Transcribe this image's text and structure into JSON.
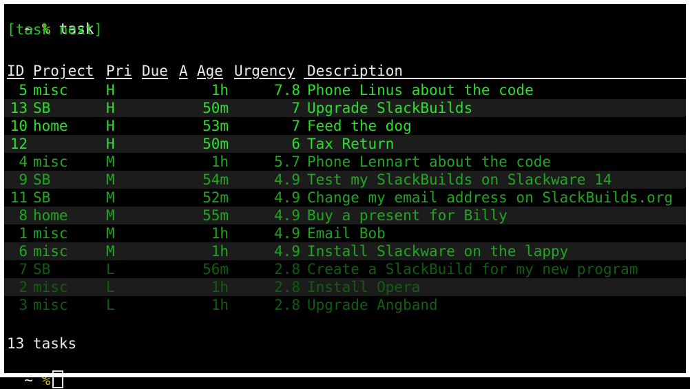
{
  "prompt": {
    "tilde": "~",
    "pct": "%",
    "command": "task"
  },
  "report_label": "[task next]",
  "columns": {
    "id": "ID",
    "project": "Project",
    "pri": "Pri",
    "due": "Due",
    "a": "A",
    "age": "Age",
    "urgency": "Urgency",
    "description": "Description"
  },
  "rows": [
    {
      "id": "5",
      "project": "misc",
      "pri": "H",
      "age": "1h",
      "urgency": "7.8",
      "description": "Phone Linus about the code",
      "color": "#2be02b"
    },
    {
      "id": "13",
      "project": "SB",
      "pri": "H",
      "age": "50m",
      "urgency": "7",
      "description": "Upgrade SlackBuilds",
      "color": "#2be02b"
    },
    {
      "id": "10",
      "project": "home",
      "pri": "H",
      "age": "53m",
      "urgency": "7",
      "description": "Feed the dog",
      "color": "#2be02b"
    },
    {
      "id": "12",
      "project": "",
      "pri": "H",
      "age": "50m",
      "urgency": "6",
      "description": "Tax Return",
      "color": "#2be02b"
    },
    {
      "id": "4",
      "project": "misc",
      "pri": "M",
      "age": "1h",
      "urgency": "5.7",
      "description": "Phone Lennart about the code",
      "color": "#1fa81f"
    },
    {
      "id": "9",
      "project": "SB",
      "pri": "M",
      "age": "54m",
      "urgency": "4.9",
      "description": "Test my SlackBuilds on Slackware 14",
      "color": "#1fa81f"
    },
    {
      "id": "11",
      "project": "SB",
      "pri": "M",
      "age": "52m",
      "urgency": "4.9",
      "description": "Change my email address on SlackBuilds.org",
      "color": "#1fa81f"
    },
    {
      "id": "8",
      "project": "home",
      "pri": "M",
      "age": "55m",
      "urgency": "4.9",
      "description": "Buy a present for Billy",
      "color": "#1fa81f"
    },
    {
      "id": "1",
      "project": "misc",
      "pri": "M",
      "age": "1h",
      "urgency": "4.9",
      "description": "Email Bob",
      "color": "#1fa81f"
    },
    {
      "id": "6",
      "project": "misc",
      "pri": "M",
      "age": "1h",
      "urgency": "4.9",
      "description": "Install Slackware on the lappy",
      "color": "#1fa81f"
    },
    {
      "id": "7",
      "project": "SB",
      "pri": "L",
      "age": "56m",
      "urgency": "2.8",
      "description": "Create a SlackBuild for my new program",
      "color": "#0f5f0f"
    },
    {
      "id": "2",
      "project": "misc",
      "pri": "L",
      "age": "1h",
      "urgency": "2.8",
      "description": "Install Opera",
      "color": "#0f5f0f"
    },
    {
      "id": "3",
      "project": "misc",
      "pri": "L",
      "age": "1h",
      "urgency": "2.8",
      "description": "Upgrade Angband",
      "color": "#0f5f0f"
    }
  ],
  "summary": "13 tasks",
  "prompt2": {
    "tilde": "~",
    "pct": "%"
  }
}
